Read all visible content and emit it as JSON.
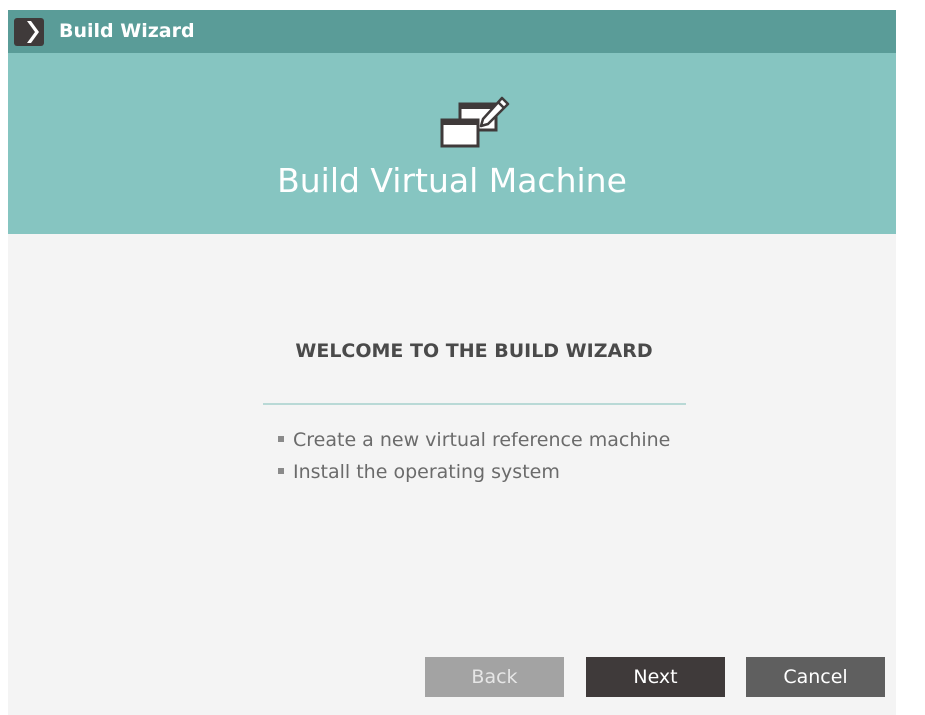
{
  "window": {
    "title": "Build Wizard",
    "app_icon": "wizard-app-icon"
  },
  "banner": {
    "icon": "virtual-machine-edit-icon",
    "title": "Build Virtual Machine"
  },
  "content": {
    "heading": "WELCOME TO THE BUILD WIZARD",
    "items": [
      "Create a new virtual reference machine",
      "Install the operating system"
    ]
  },
  "buttons": {
    "back": "Back",
    "next": "Next",
    "cancel": "Cancel"
  },
  "colors": {
    "titlebar": "#5a9c98",
    "banner": "#86c5c1",
    "content_bg": "#f4f4f4",
    "back_button": "#a3a3a3",
    "next_button": "#3f3a3a",
    "cancel_button": "#5f5f5f"
  }
}
